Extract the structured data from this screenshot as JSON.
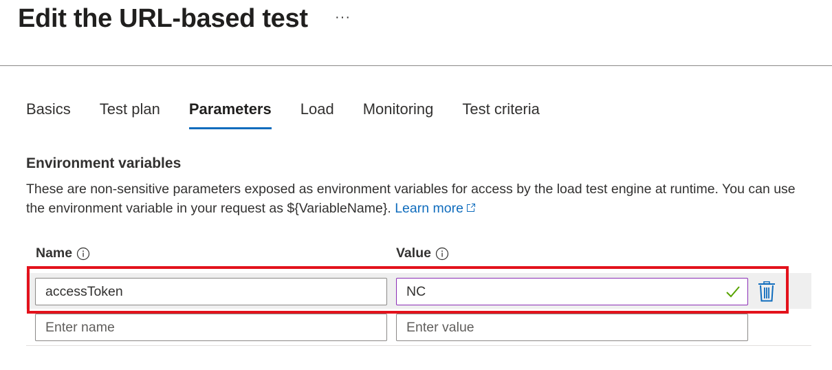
{
  "header": {
    "title": "Edit the URL-based test",
    "more_label": "···"
  },
  "tabs": [
    {
      "label": "Basics",
      "active": false
    },
    {
      "label": "Test plan",
      "active": false
    },
    {
      "label": "Parameters",
      "active": true
    },
    {
      "label": "Load",
      "active": false
    },
    {
      "label": "Monitoring",
      "active": false
    },
    {
      "label": "Test criteria",
      "active": false
    }
  ],
  "env_vars": {
    "heading": "Environment variables",
    "description": "These are non-sensitive parameters exposed as environment variables for access by the load test engine at runtime. You can use the environment variable in your request as ${VariableName}.",
    "learn_more": "Learn more",
    "columns": {
      "name": "Name",
      "value": "Value"
    },
    "rows": [
      {
        "name": "accessToken",
        "value": "NC"
      }
    ],
    "new_row": {
      "name_placeholder": "Enter name",
      "value_placeholder": "Enter value"
    }
  },
  "colors": {
    "accent": "#0f6cbd",
    "highlight": "#e3121c",
    "valid_check": "#57a300"
  },
  "icons": {
    "more": "more-icon",
    "external": "external-link-icon",
    "info": "info-icon",
    "check": "check-icon",
    "delete": "trash-icon"
  }
}
